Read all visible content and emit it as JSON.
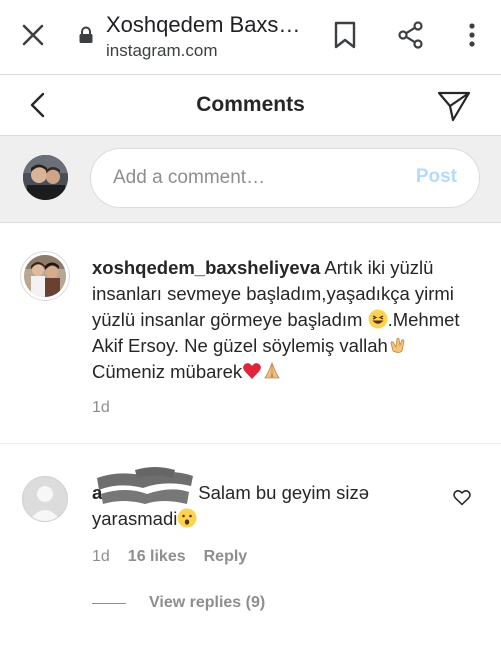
{
  "browser": {
    "title": "Xoshqedem Baxs…",
    "url": "instagram.com"
  },
  "header": {
    "title": "Comments"
  },
  "add_comment": {
    "placeholder": "Add a comment…",
    "post_label": "Post"
  },
  "caption": {
    "username": "xoshqedem_baxsheliyeva",
    "text_part1": " Artık iki yüzlü insanları sevmeye başladım,yaşadıkça yirmi yüzlü insanlar görmeye başladım ",
    "text_part2": ".Mehmet Akif Ersoy. Ne güzel söylemiş vallah",
    "text_part3": " Cümeniz mübarek",
    "time": "1d"
  },
  "reply": {
    "username_visible": "a",
    "text": "Salam bu geyim sizə yarasmadi",
    "time": "1d",
    "likes": "16 likes",
    "reply_label": "Reply",
    "view_replies": "View replies (9)"
  },
  "colors": {
    "post_disabled": "#b3dbff",
    "secondary_text": "#8e8e8e",
    "input_bar_bg": "#efefef"
  }
}
